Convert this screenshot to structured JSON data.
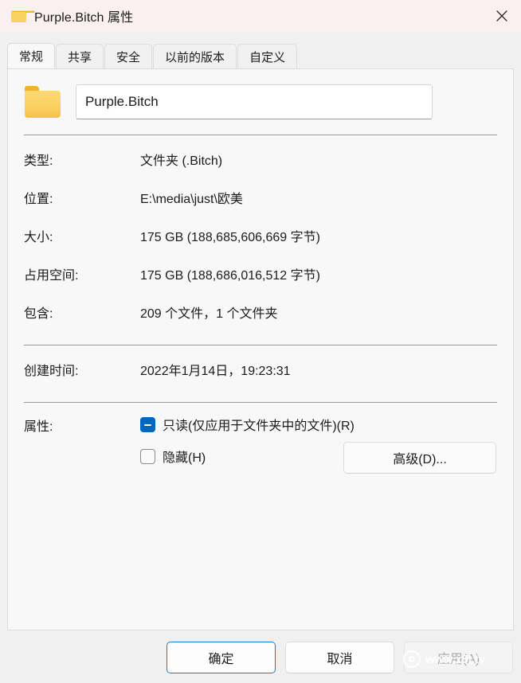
{
  "window": {
    "title": "Purple.Bitch 属性",
    "folder_icon": "folder-icon",
    "close_icon": "close-icon",
    "titlebar_color": "#faf0ef"
  },
  "tabs": [
    {
      "label": "常规",
      "active": true
    },
    {
      "label": "共享",
      "active": false
    },
    {
      "label": "安全",
      "active": false
    },
    {
      "label": "以前的版本",
      "active": false
    },
    {
      "label": "自定义",
      "active": false
    }
  ],
  "general": {
    "name_value": "Purple.Bitch",
    "rows": [
      {
        "label": "类型:",
        "value": "文件夹 (.Bitch)"
      },
      {
        "label": "位置:",
        "value": "E:\\media\\just\\欧美"
      },
      {
        "label": "大小:",
        "value": "175 GB (188,685,606,669 字节)"
      },
      {
        "label": "占用空间:",
        "value": "175 GB (188,686,016,512 字节)"
      },
      {
        "label": "包含:",
        "value": "209 个文件，1 个文件夹"
      }
    ],
    "created": {
      "label": "创建时间:",
      "value": "2022年1月14日，19:23:31"
    },
    "attributes": {
      "label": "属性:",
      "readonly": {
        "text": "只读(仅应用于文件夹中的文件)(R)",
        "state": "indeterminate"
      },
      "hidden": {
        "text": "隐藏(H)",
        "state": "unchecked"
      },
      "advanced_button": "高级(D)..."
    }
  },
  "footer": {
    "ok": "确定",
    "cancel": "取消",
    "apply": "应用(A)"
  },
  "watermark": {
    "text": "www.x8t.tv",
    "logo_icon": "circle-logo-icon"
  },
  "colors": {
    "accent": "#0067c0",
    "focus_border": "#1e7bd0",
    "folder_yellow": "#fbd164",
    "panel_bg": "#f8f8f8",
    "footer_bg": "#f0f0f0"
  }
}
